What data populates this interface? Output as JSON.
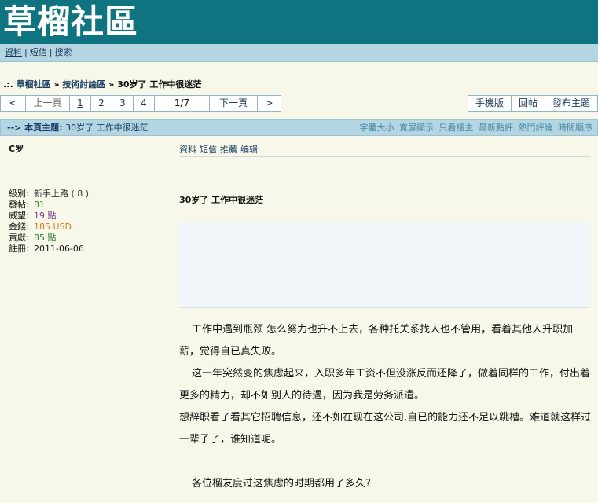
{
  "site": {
    "logo": "草榴社區"
  },
  "nav": {
    "profile": "資料",
    "messages": "短信",
    "search": "搜索"
  },
  "breadcrumb": {
    "prefix": ".:.",
    "home": "草榴社區",
    "forum": "技術討論區",
    "topic": "30岁了  工作中很迷茫",
    "separator": "»"
  },
  "pager": {
    "prev_arrow": "<",
    "prev": "上一頁",
    "pages": [
      "1",
      "2",
      "3",
      "4"
    ],
    "current": "1/7",
    "next": "下一頁",
    "next_arrow": ">"
  },
  "actions": {
    "mobile": "手機版",
    "reply": "回帖",
    "new_topic": "發布主題"
  },
  "topic_bar": {
    "label": "--> 本頁主題:",
    "title": "30岁了  工作中很迷茫",
    "options": [
      "字體大小",
      "寬屏顯示",
      "只看樓主",
      "最新點評",
      "熱門評論",
      "時間順序"
    ]
  },
  "user": {
    "name": "C罗",
    "fields": [
      {
        "label": "級別:",
        "value": "新手上路 ( 8 )",
        "color": "#333333"
      },
      {
        "label": "發帖:",
        "value": "81",
        "color": "#2f7a2a"
      },
      {
        "label": "威望:",
        "value": "19 點",
        "color": "#7a3a8a"
      },
      {
        "label": "金錢:",
        "value": "185 USD",
        "color": "#d97a18"
      },
      {
        "label": "貢獻:",
        "value": "85 點",
        "color": "#2f7a2a"
      },
      {
        "label": "註冊:",
        "value": "2011-06-06",
        "color": "#111111"
      }
    ]
  },
  "post_ops": {
    "profile": "資料",
    "messages": "短信",
    "recommend": "推薦",
    "edit": "编辑"
  },
  "post": {
    "title": "30岁了  工作中很迷茫",
    "paragraphs": [
      "工作中遇到瓶颈 怎么努力也升不上去，各种托关系找人也不管用，看着其他人升职加薪，觉得自已真失败。",
      "这一年突然变的焦虑起来，入职多年工资不但没涨反而还降了，做着同样的工作，付出着更多的精力，却不如别人的待遇，因为我是劳务派遣。",
      "想辞职看了看其它招聘信息，还不如在现在这公司,自已的能力还不足以跳槽。难道就这样过一辈子了，谁知道呢。",
      "",
      "各位榴友度过这焦虑的时期都用了多久?"
    ]
  },
  "colors": {
    "banner": "#0f7480",
    "nav": "#b3d6e2",
    "page_bg": "#f8f8ea",
    "link": "#1a3d63"
  }
}
